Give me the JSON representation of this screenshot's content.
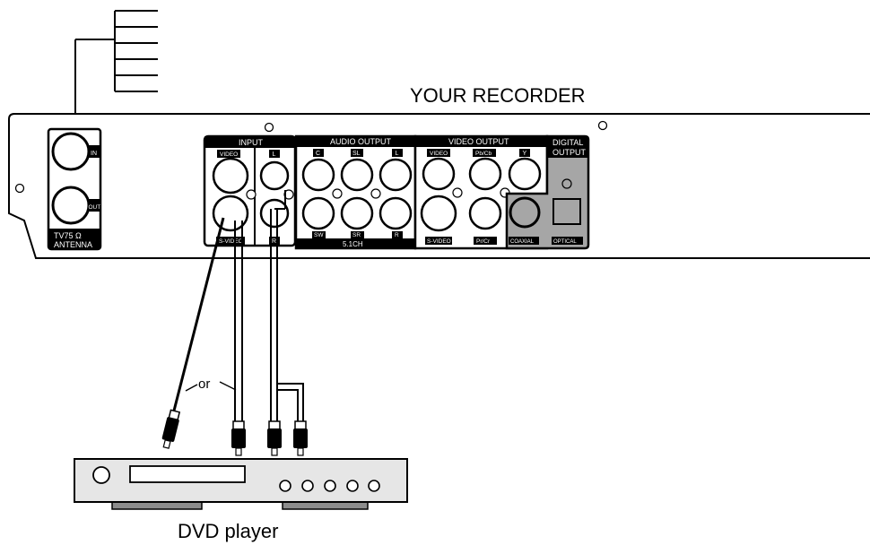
{
  "title": "YOUR RECORDER",
  "device_label": "DVD player",
  "or_label": "or",
  "antenna": {
    "in_label": "IN",
    "out_label": "OUT",
    "caption_line1": "TV75 Ω",
    "caption_line2": "ANTENNA"
  },
  "input": {
    "header": "INPUT",
    "video_label": "VIDEO",
    "svideo_label": "S-VIDEO",
    "left_label": "L",
    "right_label": "R"
  },
  "audio_output": {
    "header": "AUDIO OUTPUT",
    "top_labels": [
      "C",
      "SL",
      "L"
    ],
    "bottom_labels": [
      "SW",
      "SR",
      "R"
    ],
    "footer": "5.1CH"
  },
  "video_output": {
    "header": "VIDEO OUTPUT",
    "video_label": "VIDEO",
    "pb_label": "Pb/Cb",
    "y_label": "Y",
    "svideo_label": "S-VIDEO",
    "pr_label": "Pr/Cr"
  },
  "digital_output": {
    "header_line1": "DIGITAL",
    "header_line2": "OUTPUT",
    "coaxial_label": "COAXIAL",
    "optical_label": "OPTICAL"
  },
  "colors": {
    "line": "#000000",
    "panel_fill": "#ffffff",
    "digital_fill": "#a6a6a6",
    "device_fill": "#e6e6e6",
    "device_feet": "#8c8c8c"
  }
}
